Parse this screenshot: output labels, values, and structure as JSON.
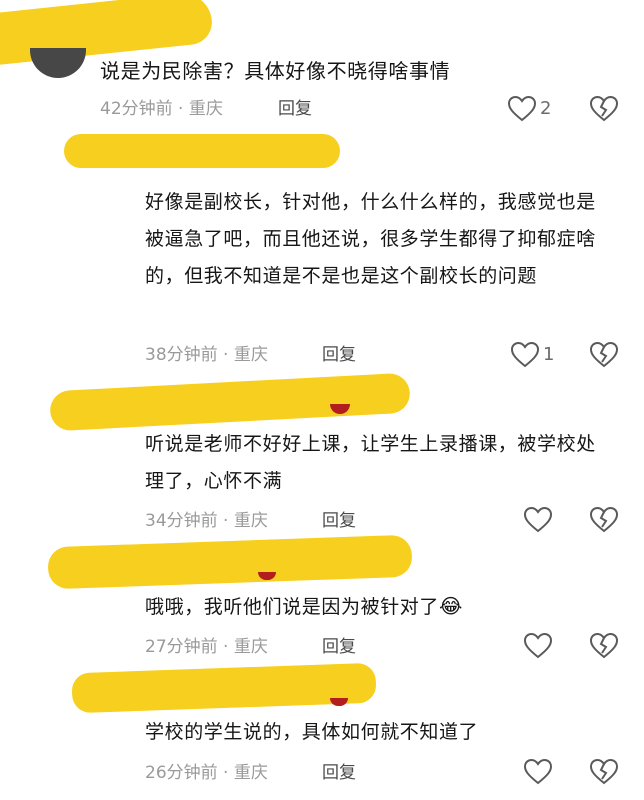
{
  "colors": {
    "highlight": "#f7cf1f",
    "meta_text": "#9a9a9a",
    "icon_stroke": "#5a5a5a"
  },
  "comments": [
    {
      "text": "说是为民除害？具体好像不晓得啥事情",
      "time": "42分钟前",
      "location": "重庆",
      "reply_label": "回复",
      "likes": "2",
      "like_icon": "heart-outline-icon",
      "dislike_icon": "broken-heart-icon"
    },
    {
      "text": "好像是副校长，针对他，什么什么样的，我感觉也是被逼急了吧，而且他还说，很多学生都得了抑郁症啥的，但我不知道是不是也是这个副校长的问题",
      "time": "38分钟前",
      "location": "重庆",
      "reply_label": "回复",
      "likes": "1",
      "like_icon": "heart-outline-icon",
      "dislike_icon": "broken-heart-icon"
    },
    {
      "text": "听说是老师不好好上课，让学生上录播课，被学校处理了，心怀不满",
      "time": "34分钟前",
      "location": "重庆",
      "reply_label": "回复",
      "likes": "",
      "like_icon": "heart-outline-icon",
      "dislike_icon": "broken-heart-icon"
    },
    {
      "text": "哦哦，我听他们说是因为被针对了",
      "emoji": "😂",
      "time": "27分钟前",
      "location": "重庆",
      "reply_label": "回复",
      "likes": "",
      "like_icon": "heart-outline-icon",
      "dislike_icon": "broken-heart-icon"
    },
    {
      "text": "学校的学生说的，具体如何就不知道了",
      "time": "26分钟前",
      "location": "重庆",
      "reply_label": "回复",
      "likes": "",
      "like_icon": "heart-outline-icon",
      "dislike_icon": "broken-heart-icon"
    }
  ]
}
